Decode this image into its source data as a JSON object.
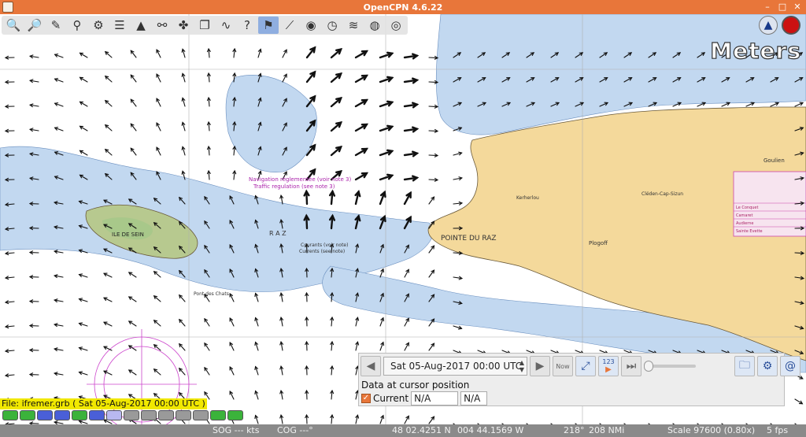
{
  "window": {
    "title": "OpenCPN 4.6.22"
  },
  "toolbar": {
    "buttons": [
      {
        "name": "zoom-in",
        "glyph": "🔍"
      },
      {
        "name": "zoom-out",
        "glyph": "🔎"
      },
      {
        "name": "route",
        "glyph": "✎"
      },
      {
        "name": "mark",
        "glyph": "⚲"
      },
      {
        "name": "settings",
        "glyph": "⚙"
      },
      {
        "name": "text",
        "glyph": "☰"
      },
      {
        "name": "ais",
        "glyph": "▲"
      },
      {
        "name": "routes-manager",
        "glyph": "⚯"
      },
      {
        "name": "tracks",
        "glyph": "✤"
      },
      {
        "name": "copy",
        "glyph": "❐"
      },
      {
        "name": "tide",
        "glyph": "∿"
      },
      {
        "name": "help",
        "glyph": "?"
      },
      {
        "name": "grib",
        "glyph": "⚑"
      },
      {
        "name": "measure",
        "glyph": "⟋"
      },
      {
        "name": "record",
        "glyph": "◉"
      },
      {
        "name": "history",
        "glyph": "◷"
      },
      {
        "name": "weather",
        "glyph": "≋"
      },
      {
        "name": "globe",
        "glyph": "◍"
      },
      {
        "name": "lifebuoy",
        "glyph": "◎"
      }
    ],
    "compass_glyph": "▲"
  },
  "overlay": {
    "units": "Meters"
  },
  "chart_labels": {
    "pointe_du_raz": "POINTE DU RAZ",
    "ile_de_sein": "ILE DE SEIN",
    "plogoff": "Plogoff",
    "goulien": "Goulien",
    "cleden": "Cléden-Cap-Sizun",
    "kerherlo": "Kerherlou",
    "nav_reg": "Navigation réglementée (voir note 3)",
    "traffic_reg": "Traffic regulation (see note 3)",
    "currents_note": "Courants (voir note)",
    "currents_note2": "Currents (see note)",
    "raz_letter": "R A Z",
    "pont_chat": "Pont des Chats",
    "table_rows": [
      "Le Conquet",
      "Camaret",
      "Audierne",
      "Sainte Evette"
    ]
  },
  "grib": {
    "time": "Sat 05-Aug-2017 00:00  UTC",
    "now_label": "Now",
    "counter_label": "123",
    "heading": "Data at cursor position",
    "current_label": "Current",
    "current_value1": "N/A",
    "current_value2": "N/A",
    "file_label": "File: ifremer.grb ( Sat 05-Aug-2017 00:00  UTC )"
  },
  "quilt": {
    "colors": [
      "#3bb33b",
      "#3bb33b",
      "#4a5fd8",
      "#4a5fd8",
      "#3bb33b",
      "#4a5fd8",
      "#b8b8f0",
      "#9a9a9a",
      "#9a9a9a",
      "#9a9a9a",
      "#9a9a9a",
      "#9a9a9a",
      "#3bb33b",
      "#3bb33b"
    ]
  },
  "status": {
    "sog": "SOG --- kts",
    "cog": "COG ---°",
    "lat": "48 02.4251 N",
    "lon": "004 44.1569 W",
    "bearing": "218°",
    "range": "208 NMi",
    "scale": "Scale 97600 (0.80x)",
    "fps": "5 fps"
  },
  "colors": {
    "titlebar": "#e8763a",
    "sea_deep": "#ffffff",
    "sea_shallow": "#c2d8f0",
    "land": "#f4d99b",
    "foreshore": "#a8c88a"
  }
}
